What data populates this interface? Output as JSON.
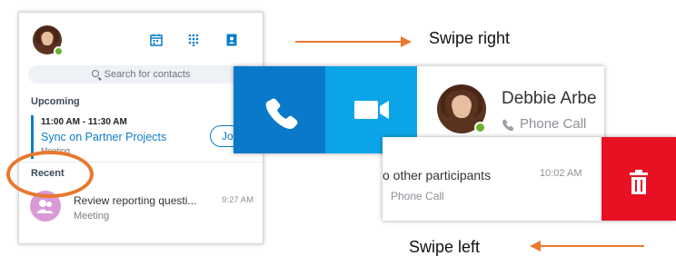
{
  "colors": {
    "accent_blue": "#0b79c9",
    "video_blue": "#0ca4e8",
    "delete_red": "#e81123",
    "annotation_orange": "#e8792e",
    "presence_green": "#6ab42d"
  },
  "panel": {
    "header_icons": [
      "calendar-icon",
      "dialpad-icon",
      "contacts-icon"
    ],
    "search_placeholder": "Search for contacts",
    "upcoming_heading": "Upcoming",
    "meeting": {
      "time": "11:00 AM - 11:30 AM",
      "title": "Sync on Partner Projects",
      "subtitle": "Meeting",
      "join_label": "Join"
    },
    "recent_heading": "Recent",
    "recent_item": {
      "title": "Review reporting questi...",
      "subtitle": "Meeting",
      "time": "9:27 AM"
    }
  },
  "swipe_right": {
    "caption": "Swipe right",
    "actions": [
      "phone-icon",
      "video-icon"
    ],
    "contact_name": "Debbie Arbe",
    "contact_sub": "Phone Call"
  },
  "swipe_left": {
    "caption": "Swipe left",
    "title": "o other participants",
    "subtitle": "Phone Call",
    "time": "10:02 AM",
    "action": "trash-icon"
  }
}
